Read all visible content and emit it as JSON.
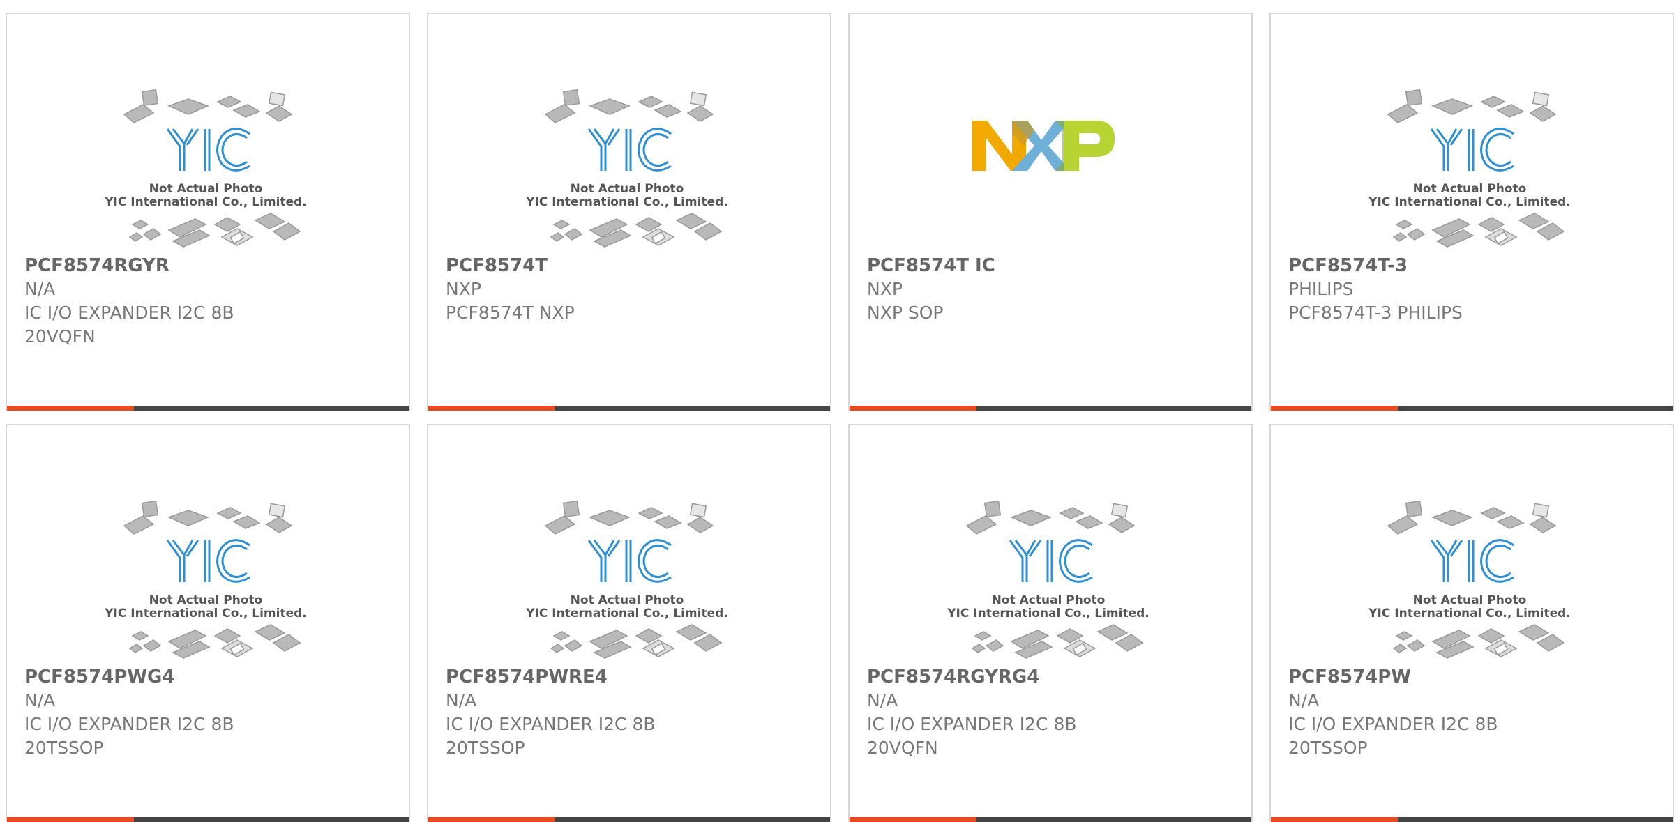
{
  "colors": {
    "accent_orange": "#e84b1f",
    "bar_dark": "#444444",
    "text_gray": "#666666",
    "yic_blue": "#2f8fd3"
  },
  "placeholder_image": {
    "line1": "Not Actual Photo",
    "line2": "YIC International Co., Limited."
  },
  "products": [
    {
      "part": "PCF8574RGYR",
      "manufacturer": "N/A",
      "desc1": "IC I/O EXPANDER I2C 8B",
      "desc2": "20VQFN",
      "image": "yic-placeholder"
    },
    {
      "part": "PCF8574T",
      "manufacturer": "NXP",
      "desc1": "PCF8574T NXP",
      "desc2": "",
      "image": "yic-placeholder"
    },
    {
      "part": "PCF8574T IC",
      "manufacturer": "NXP",
      "desc1": "NXP SOP",
      "desc2": "",
      "image": "nxp-logo"
    },
    {
      "part": "PCF8574T-3",
      "manufacturer": "PHILIPS",
      "desc1": "PCF8574T-3 PHILIPS",
      "desc2": "",
      "image": "yic-placeholder"
    },
    {
      "part": "PCF8574PWG4",
      "manufacturer": "N/A",
      "desc1": "IC I/O EXPANDER I2C 8B",
      "desc2": "20TSSOP",
      "image": "yic-placeholder"
    },
    {
      "part": "PCF8574PWRE4",
      "manufacturer": "N/A",
      "desc1": "IC I/O EXPANDER I2C 8B",
      "desc2": "20TSSOP",
      "image": "yic-placeholder"
    },
    {
      "part": "PCF8574RGYRG4",
      "manufacturer": "N/A",
      "desc1": "IC I/O EXPANDER I2C 8B",
      "desc2": "20VQFN",
      "image": "yic-placeholder"
    },
    {
      "part": "PCF8574PW",
      "manufacturer": "N/A",
      "desc1": "IC I/O EXPANDER I2C 8B",
      "desc2": "20TSSOP",
      "image": "yic-placeholder"
    }
  ]
}
